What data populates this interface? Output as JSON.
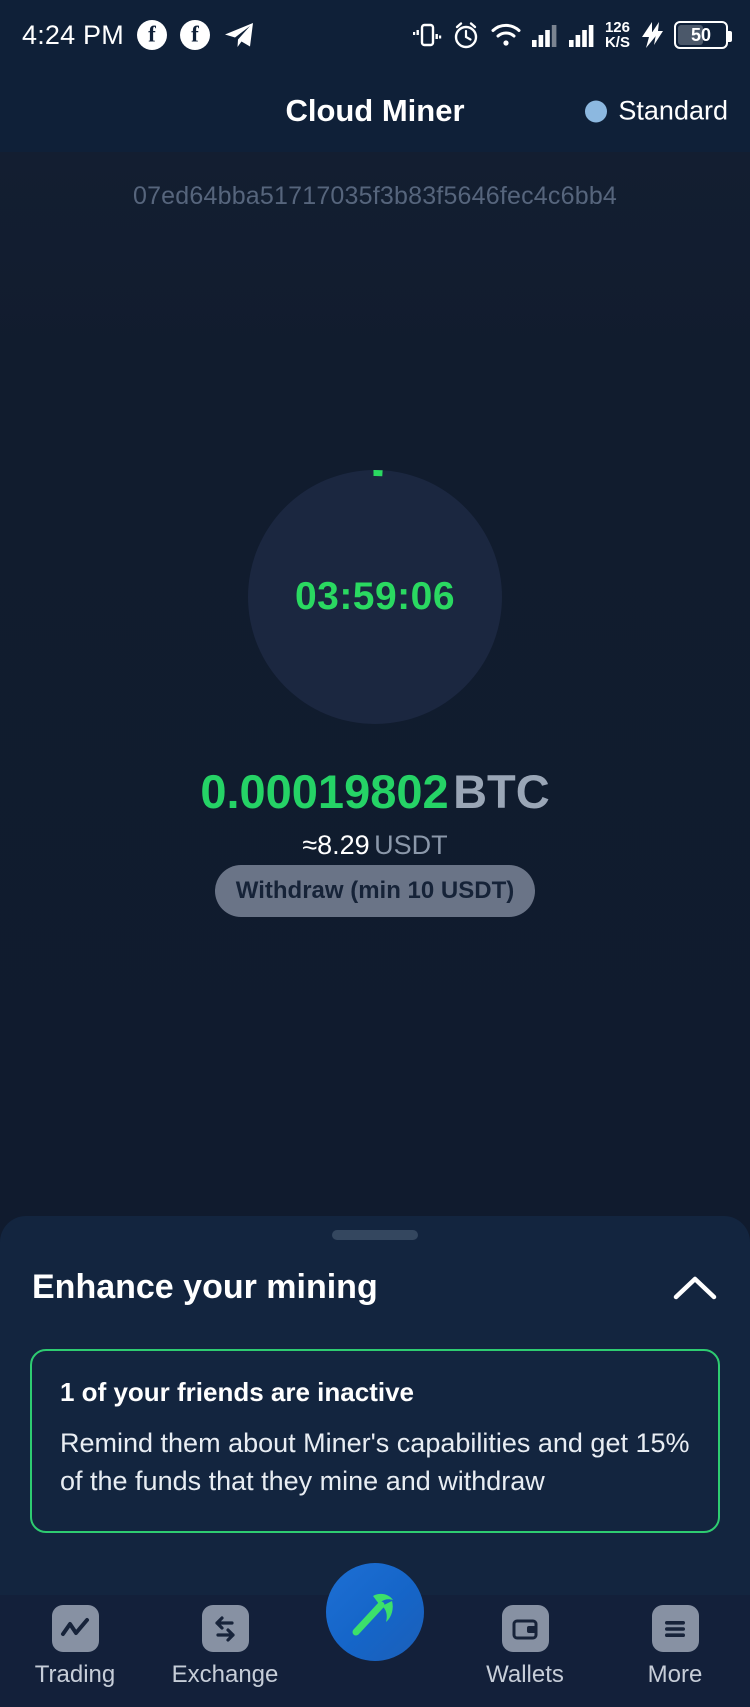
{
  "statusbar": {
    "time": "4:24 PM",
    "app_icons": [
      "facebook-icon",
      "facebook-icon",
      "telegram-icon"
    ],
    "right_icons": [
      "vibrate-icon",
      "alarm-icon",
      "wifi-icon",
      "signal-icon",
      "signal-icon"
    ],
    "data_rate_value": "126",
    "data_rate_unit": "K/S",
    "charging_icon": "charging-bolt-icon",
    "battery_level": "50"
  },
  "header": {
    "title": "Cloud Miner",
    "plan_label": "Standard",
    "plan_dot_color": "#8cb8e0"
  },
  "main": {
    "hash": "07ed64bba51717035f3b83f5646fec4c6bb4",
    "timer": "03:59:06",
    "timer_color": "#2ad961",
    "amount_value": "0.00019802",
    "amount_currency": "BTC",
    "amount_color": "#25d366",
    "approx_value": "≈8.29",
    "approx_currency": "USDT",
    "withdraw_label": "Withdraw (min 10 USDT)"
  },
  "sheet": {
    "title": "Enhance your mining",
    "collapse_icon": "chevron-up-icon",
    "card": {
      "title": "1 of your friends are inactive",
      "description": "Remind them about Miner's capabilities and get 15% of the funds that they mine and withdraw",
      "border_color": "#2ecc71"
    }
  },
  "navbar": {
    "items": [
      {
        "label": "Trading",
        "icon": "chart-line-icon"
      },
      {
        "label": "Exchange",
        "icon": "swap-arrows-icon"
      },
      {
        "label": "",
        "icon": "pickaxe-icon"
      },
      {
        "label": "Wallets",
        "icon": "wallet-icon"
      },
      {
        "label": "More",
        "icon": "menu-lines-icon"
      }
    ],
    "fab_icon": "pickaxe-icon",
    "fab_icon_color": "#3ce06b"
  }
}
